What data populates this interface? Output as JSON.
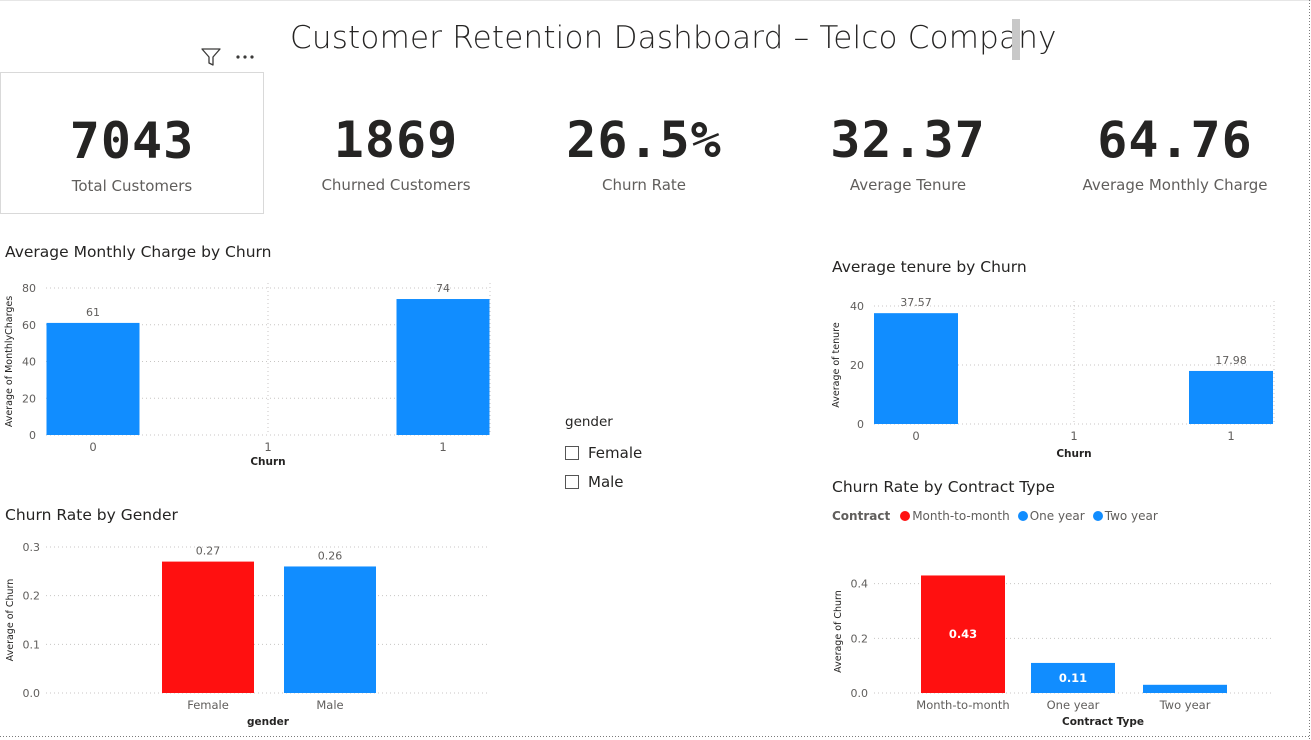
{
  "page": {
    "title": "Customer Retention Dashboard – Telco Company"
  },
  "visual_header": {
    "icons": [
      "filter-icon",
      "more-options-icon"
    ]
  },
  "colors": {
    "blue": "#118DFF",
    "red": "#FF1010",
    "text": "#252423",
    "muted": "#605e5c"
  },
  "kpis": [
    {
      "value": "7043",
      "label": "Total Customers"
    },
    {
      "value": "1869",
      "label": "Churned Customers"
    },
    {
      "value": "26.5%",
      "label": "Churn Rate"
    },
    {
      "value": "32.37",
      "label": "Average Tenure"
    },
    {
      "value": "64.76",
      "label": "Average Monthly Charge"
    }
  ],
  "slicer": {
    "title": "gender",
    "options": [
      "Female",
      "Male"
    ]
  },
  "chart_data": [
    {
      "id": "monthly",
      "type": "bar",
      "title": "Average Monthly Charge by Churn",
      "xlabel": "Churn",
      "ylabel": "Average of MonthlyCharges",
      "ylim": [
        0,
        80
      ],
      "yticks": [
        "0",
        "20",
        "40",
        "60",
        "80"
      ],
      "categories": [
        "0",
        "1",
        "1"
      ],
      "values": [
        61,
        null,
        74
      ],
      "data_labels": [
        "61",
        "",
        "74"
      ],
      "colors": [
        "#118DFF",
        "#118DFF",
        "#118DFF"
      ],
      "grid": true
    },
    {
      "id": "tenure",
      "type": "bar",
      "title": "Average tenure by Churn",
      "xlabel": "Churn",
      "ylabel": "Average of tenure",
      "ylim": [
        0,
        40
      ],
      "yticks": [
        "0",
        "20",
        "40"
      ],
      "categories": [
        "0",
        "1",
        "1"
      ],
      "values": [
        37.57,
        null,
        17.98
      ],
      "data_labels": [
        "37.57",
        "",
        "17.98"
      ],
      "colors": [
        "#118DFF",
        "#118DFF",
        "#118DFF"
      ],
      "grid": true
    },
    {
      "id": "gender",
      "type": "bar",
      "title": "Churn Rate by Gender",
      "xlabel": "gender",
      "ylabel": "Average of Churn",
      "ylim": [
        0,
        0.3
      ],
      "yticks": [
        "0.0",
        "0.1",
        "0.2",
        "0.3"
      ],
      "categories": [
        "Female",
        "Male"
      ],
      "values": [
        0.27,
        0.26
      ],
      "data_labels": [
        "0.27",
        "0.26"
      ],
      "colors": [
        "#FF1010",
        "#118DFF"
      ],
      "grid": true
    },
    {
      "id": "contract",
      "type": "bar",
      "title": "Churn Rate by Contract Type",
      "xlabel": "Contract Type",
      "ylabel": "Average of Churn",
      "ylim": [
        0,
        0.45
      ],
      "yticks": [
        "0.0",
        "0.2",
        "0.4"
      ],
      "categories": [
        "Month-to-month",
        "One year",
        "Two year"
      ],
      "values": [
        0.43,
        0.11,
        0.03
      ],
      "data_labels": [
        "0.43",
        "0.11",
        ""
      ],
      "colors": [
        "#FF1010",
        "#118DFF",
        "#118DFF"
      ],
      "legend": {
        "title": "Contract",
        "items": [
          {
            "name": "Month-to-month",
            "color": "#FF1010"
          },
          {
            "name": "One year",
            "color": "#118DFF"
          },
          {
            "name": "Two year",
            "color": "#118DFF"
          }
        ],
        "placement": "top-left"
      },
      "grid": true
    }
  ]
}
